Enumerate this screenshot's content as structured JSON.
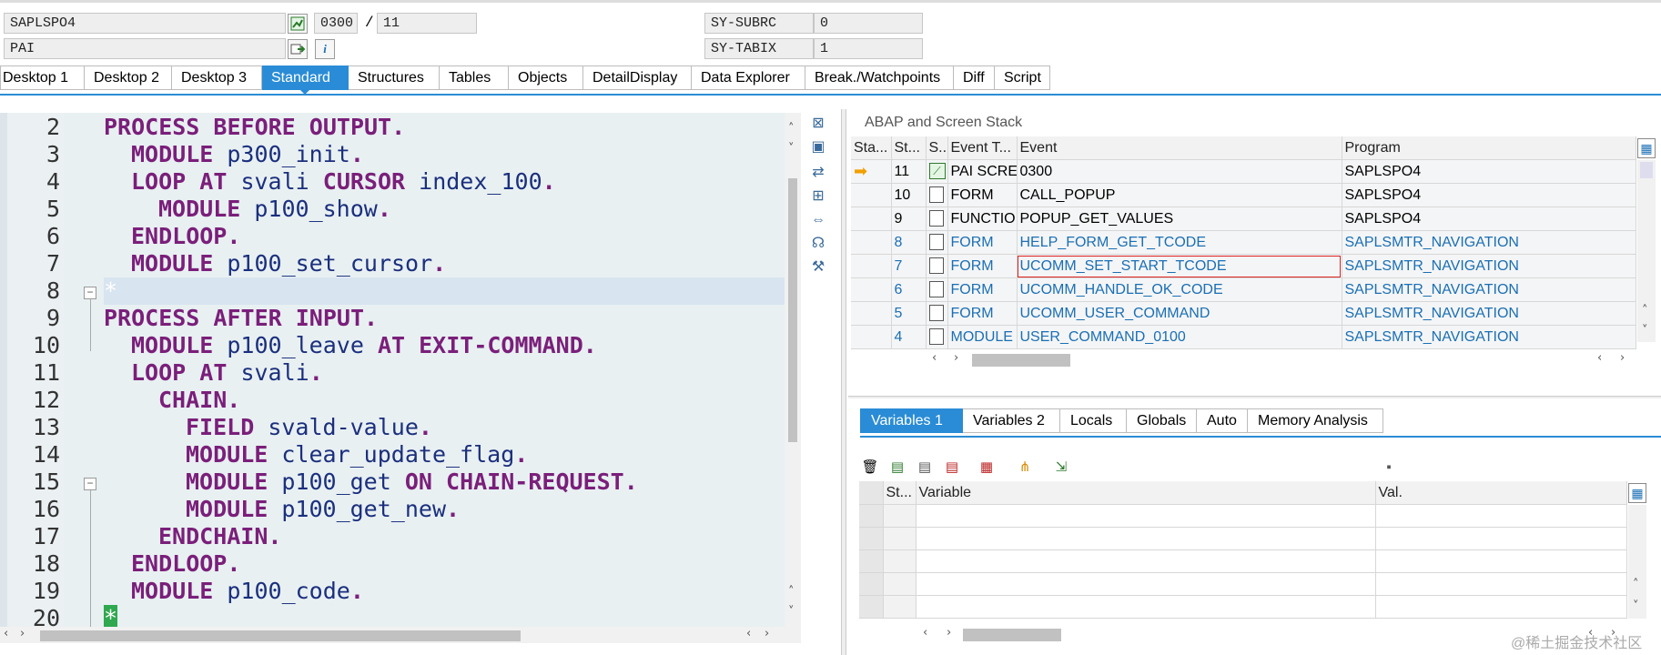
{
  "header": {
    "program_field": "SAPLSPO4",
    "event_field": "PAI",
    "screen_number": "0300",
    "separator": "/",
    "line_number": "11",
    "sy_subrc_label": "SY-SUBRC",
    "sy_subrc_value": "0",
    "sy_tabix_label": "SY-TABIX",
    "sy_tabix_value": "1"
  },
  "tabs": [
    "Desktop 1",
    "Desktop 2",
    "Desktop 3",
    "Standard",
    "Structures",
    "Tables",
    "Objects",
    "DetailDisplay",
    "Data Explorer",
    "Break./Watchpoints",
    "Diff",
    "Script"
  ],
  "active_tab": "Standard",
  "editor": {
    "lines": [
      {
        "n": "2",
        "text": "PROCESS BEFORE OUTPUT."
      },
      {
        "n": "3",
        "text": "MODULE p300_init."
      },
      {
        "n": "4",
        "text": "LOOP AT svali CURSOR index_100."
      },
      {
        "n": "5",
        "text": "MODULE p100_show."
      },
      {
        "n": "6",
        "text": "ENDLOOP."
      },
      {
        "n": "7",
        "text": "MODULE p100_set_cursor."
      },
      {
        "n": "8",
        "text": "*"
      },
      {
        "n": "9",
        "text": "PROCESS AFTER INPUT."
      },
      {
        "n": "10",
        "text": "MODULE p100_leave AT EXIT-COMMAND."
      },
      {
        "n": "11",
        "text": "LOOP AT svali."
      },
      {
        "n": "12",
        "text": "CHAIN."
      },
      {
        "n": "13",
        "text": "FIELD svald-value."
      },
      {
        "n": "14",
        "text": "MODULE clear_update_flag."
      },
      {
        "n": "15",
        "text": "MODULE p100_get ON CHAIN-REQUEST."
      },
      {
        "n": "16",
        "text": "MODULE p100_get_new."
      },
      {
        "n": "17",
        "text": "ENDCHAIN."
      },
      {
        "n": "18",
        "text": "ENDLOOP."
      },
      {
        "n": "19",
        "text": "MODULE p100_code."
      },
      {
        "n": "20",
        "text": "*"
      }
    ]
  },
  "stack": {
    "title": "ABAP and Screen Stack",
    "columns": [
      "Sta...",
      "St...",
      "S...",
      "Event T...",
      "Event",
      "Program"
    ],
    "rows": [
      {
        "level": "11",
        "type": "PAI SCRE...",
        "event": "0300",
        "program": "SAPLSPO4",
        "link": false,
        "current": true
      },
      {
        "level": "10",
        "type": "FORM",
        "event": "CALL_POPUP",
        "program": "SAPLSPO4",
        "link": false,
        "current": false
      },
      {
        "level": "9",
        "type": "FUNCTIO...",
        "event": "POPUP_GET_VALUES",
        "program": "SAPLSPO4",
        "link": false,
        "current": false
      },
      {
        "level": "8",
        "type": "FORM",
        "event": "HELP_FORM_GET_TCODE",
        "program": "SAPLSMTR_NAVIGATION",
        "link": true,
        "current": false
      },
      {
        "level": "7",
        "type": "FORM",
        "event": "UCOMM_SET_START_TCODE",
        "program": "SAPLSMTR_NAVIGATION",
        "link": true,
        "current": false
      },
      {
        "level": "6",
        "type": "FORM",
        "event": "UCOMM_HANDLE_OK_CODE",
        "program": "SAPLSMTR_NAVIGATION",
        "link": true,
        "current": false
      },
      {
        "level": "5",
        "type": "FORM",
        "event": "UCOMM_USER_COMMAND",
        "program": "SAPLSMTR_NAVIGATION",
        "link": true,
        "current": false
      },
      {
        "level": "4",
        "type": "MODULE ...",
        "event": "USER_COMMAND_0100",
        "program": "SAPLSMTR_NAVIGATION",
        "link": true,
        "current": false
      }
    ]
  },
  "vars": {
    "tabs": [
      "Variables 1",
      "Variables 2",
      "Locals",
      "Globals",
      "Auto",
      "Memory Analysis"
    ],
    "active_tab": "Variables 1",
    "columns": [
      "St...",
      "Variable",
      "Val."
    ]
  },
  "watermark": "@稀土掘金技术社区",
  "colors": {
    "accent": "#2a8cd6",
    "keyword": "#7a1f7a",
    "identifier": "#1b2f7d",
    "link": "#1a6fb5"
  }
}
